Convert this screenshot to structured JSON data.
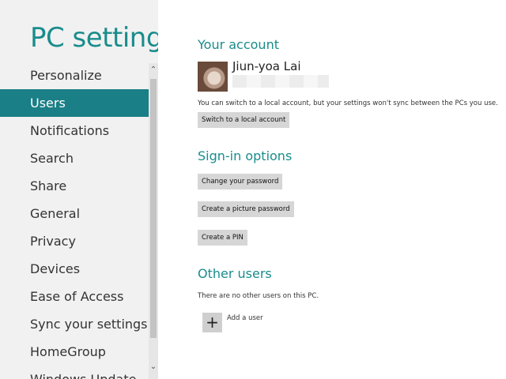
{
  "app": {
    "title": "PC settings"
  },
  "nav": {
    "items": [
      {
        "label": "Personalize"
      },
      {
        "label": "Users"
      },
      {
        "label": "Notifications"
      },
      {
        "label": "Search"
      },
      {
        "label": "Share"
      },
      {
        "label": "General"
      },
      {
        "label": "Privacy"
      },
      {
        "label": "Devices"
      },
      {
        "label": "Ease of Access"
      },
      {
        "label": "Sync your settings"
      },
      {
        "label": "HomeGroup"
      },
      {
        "label": "Windows Update"
      }
    ],
    "selected_index": 1
  },
  "account": {
    "heading": "Your account",
    "user_name": "Jiun-yoa Lai",
    "description": "You can switch to a local account, but your settings won't sync between the PCs you use.",
    "switch_button": "Switch to a local account"
  },
  "signin": {
    "heading": "Sign-in options",
    "change_password": "Change your password",
    "picture_password": "Create a picture password",
    "create_pin": "Create a PIN"
  },
  "other_users": {
    "heading": "Other users",
    "empty_text": "There are no other users on this PC.",
    "add_user_label": "Add a user"
  },
  "icons": {
    "add": "plus-icon",
    "scroll_up": "chevron-up-icon",
    "scroll_down": "chevron-down-icon"
  },
  "colors": {
    "accent": "#1a8c8c",
    "selected_bg": "#1a7f86",
    "left_pane_bg": "#f1f1f1",
    "button_bg": "#d6d6d6"
  }
}
